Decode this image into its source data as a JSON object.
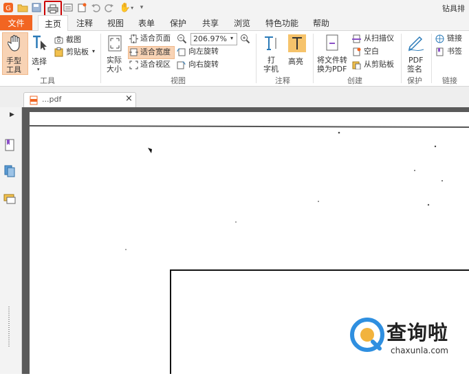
{
  "app_title": "钻具排",
  "quick_access": [
    "logo-icon",
    "open-icon",
    "save-icon",
    "print-icon",
    "doc-icon",
    "new-icon",
    "undo-icon",
    "redo-icon",
    "hand-dropdown-icon",
    "customize-icon"
  ],
  "menu": {
    "file": "文件",
    "tabs": [
      "主页",
      "注释",
      "视图",
      "表单",
      "保护",
      "共享",
      "浏览",
      "特色功能",
      "帮助"
    ]
  },
  "ribbon": {
    "tools": {
      "hand_line1": "手型",
      "hand_line2": "工具",
      "select": "选择",
      "screenshot": "截图",
      "clipboard": "剪贴板",
      "group": "工具"
    },
    "view": {
      "actual_size_line1": "实际",
      "actual_size_line2": "大小",
      "fit_page": "适合页面",
      "fit_width": "适合宽度",
      "fit_visible": "适合视区",
      "zoom": "206.97%",
      "rotate_left": "向左旋转",
      "rotate_right": "向右旋转",
      "group": "视图"
    },
    "comment": {
      "typewriter_line1": "打",
      "typewriter_line2": "字机",
      "highlight": "高亮",
      "group": "注释"
    },
    "create": {
      "convert_line1": "将文件转",
      "convert_line2": "换为PDF",
      "from_scanner": "从扫描仪",
      "blank": "空白",
      "from_clipboard": "从剪贴板",
      "group": "创建"
    },
    "protect": {
      "sign_line1": "PDF",
      "sign_line2": "签名",
      "group": "保护"
    },
    "links": {
      "link": "链接",
      "bookmark": "书签",
      "group": "链接"
    }
  },
  "doc_tab": {
    "filename": "...pdf",
    "close": "×"
  },
  "watermark": {
    "text": "查询啦",
    "domain": "chaxunla.com"
  },
  "colors": {
    "accent": "#f26522",
    "print_highlight": "#cc0000",
    "ribbon_active": "#f8d3b5"
  }
}
